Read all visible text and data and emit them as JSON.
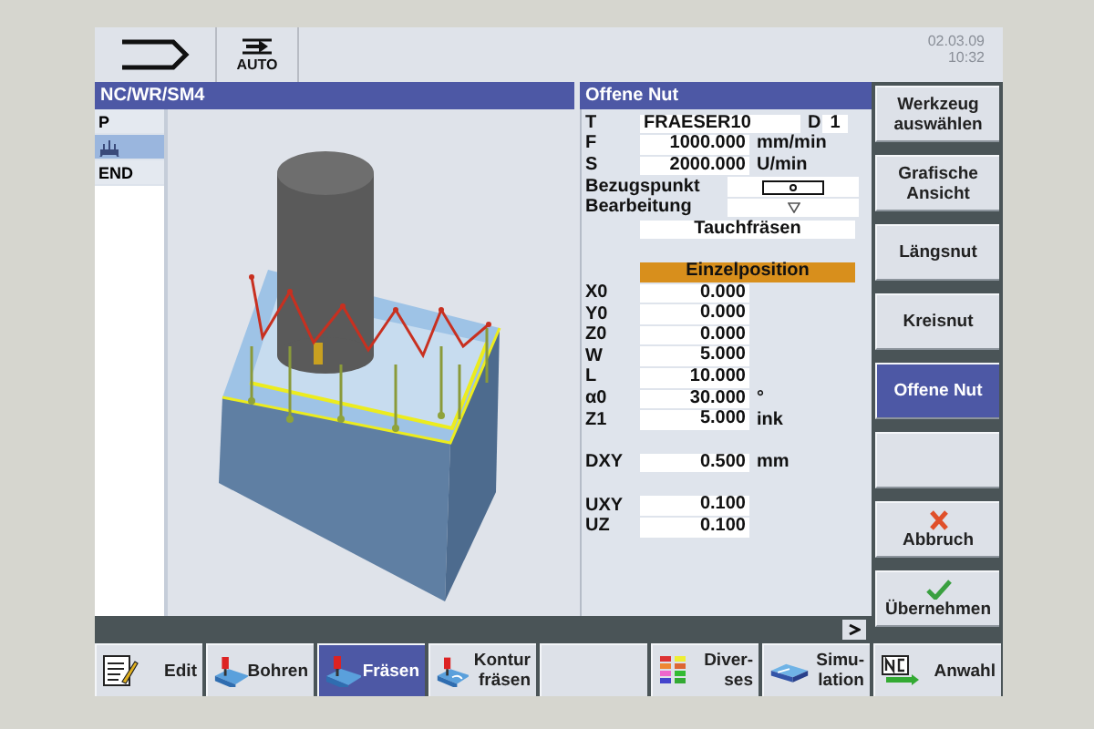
{
  "status": {
    "mode": "AUTO",
    "date": "02.03.09",
    "time": "10:32"
  },
  "program": {
    "path": "NC/WR/SM4",
    "blocks": [
      {
        "kind": "text",
        "label": "P",
        "selected": false
      },
      {
        "kind": "icon",
        "selected": true
      },
      {
        "kind": "text",
        "label": "END",
        "selected": false
      }
    ]
  },
  "form": {
    "title": "Offene Nut",
    "sections": [
      {
        "rows": [
          {
            "kind": "tool",
            "label": "T",
            "value": "FRAESER10",
            "extra_label": "D",
            "extra_value": "1"
          },
          {
            "kind": "field",
            "label": "F",
            "value": "1000.000",
            "unit": "mm/min"
          },
          {
            "kind": "field",
            "label": "S",
            "value": "2000.000",
            "unit": "U/min"
          },
          {
            "kind": "symbol",
            "label": "Bezugspunkt"
          },
          {
            "kind": "select",
            "label": "Bearbeitung"
          },
          {
            "kind": "wide",
            "value": "Tauchfräsen"
          }
        ]
      },
      {
        "rows": [
          {
            "kind": "header",
            "value": "Einzelposition"
          },
          {
            "kind": "field",
            "label": "X0",
            "value": "0.000"
          },
          {
            "kind": "field",
            "label": "Y0",
            "value": "0.000"
          },
          {
            "kind": "field",
            "label": "Z0",
            "value": "0.000"
          },
          {
            "kind": "field",
            "label": "W",
            "value": "5.000"
          },
          {
            "kind": "field",
            "label": "L",
            "value": "10.000"
          },
          {
            "kind": "field",
            "label": "α0",
            "value": "30.000",
            "unit": "°"
          },
          {
            "kind": "field",
            "label": "Z1",
            "value": "5.000",
            "unit": "ink"
          }
        ]
      },
      {
        "rows": [
          {
            "kind": "field",
            "label": "DXY",
            "value": "0.500",
            "unit": "mm"
          }
        ]
      },
      {
        "rows": [
          {
            "kind": "field",
            "label": "UXY",
            "value": "0.100"
          },
          {
            "kind": "field",
            "label": "UZ",
            "value": "0.100"
          }
        ]
      }
    ]
  },
  "vertical_softkeys": [
    {
      "kind": "plain",
      "label": "Werkzeug auswählen",
      "selected": false
    },
    {
      "kind": "plain",
      "label": "Grafische Ansicht",
      "selected": false
    },
    {
      "kind": "plain",
      "label": "Längsnut",
      "selected": false
    },
    {
      "kind": "plain",
      "label": "Kreisnut",
      "selected": false
    },
    {
      "kind": "plain",
      "label": "Offene Nut",
      "selected": true
    },
    {
      "kind": "blank",
      "selected": false
    },
    {
      "kind": "cancel",
      "label": "Abbruch",
      "selected": false
    },
    {
      "kind": "accept",
      "label": "Übernehmen",
      "selected": false
    }
  ],
  "horizontal_softkeys": [
    {
      "kind": "edit",
      "label": "Edit",
      "selected": false
    },
    {
      "kind": "drill",
      "label": "Bohren",
      "selected": false
    },
    {
      "kind": "mill",
      "label": "Fräsen",
      "selected": true
    },
    {
      "kind": "contour",
      "label": "Kontur fräsen",
      "selected": false
    },
    {
      "kind": "blank",
      "selected": false
    },
    {
      "kind": "misc",
      "label": "Diver-ses",
      "selected": false
    },
    {
      "kind": "simulation",
      "label": "Simu-lation",
      "selected": false
    },
    {
      "kind": "select",
      "label": "Anwahl",
      "selected": false
    }
  ]
}
